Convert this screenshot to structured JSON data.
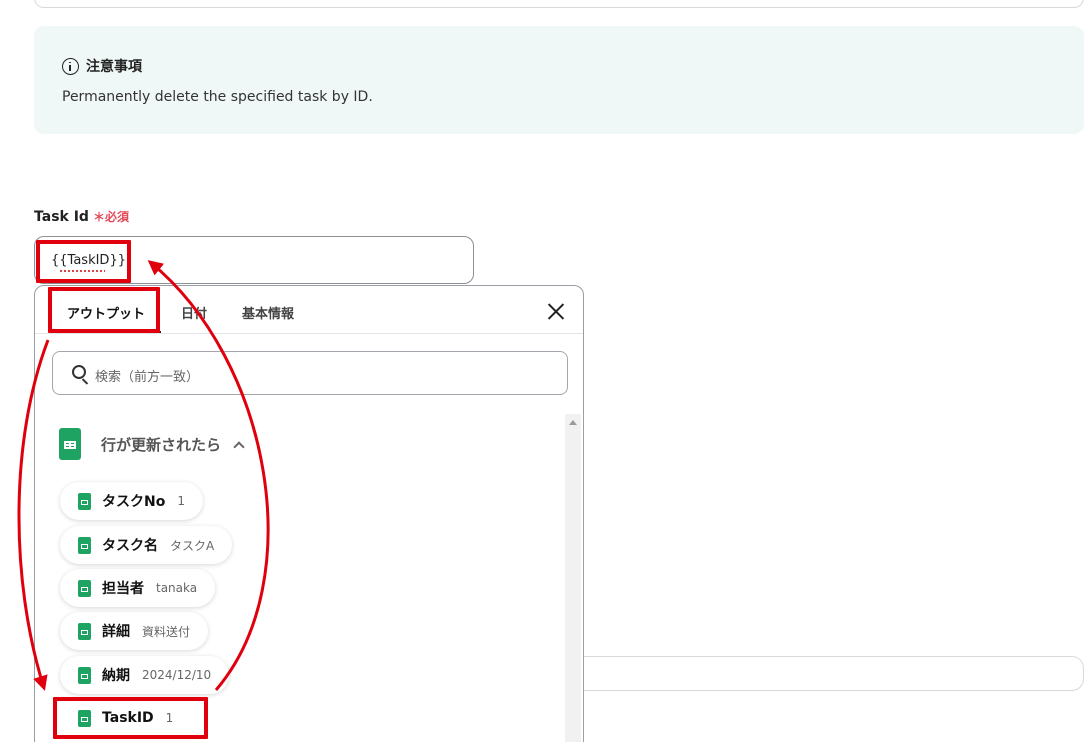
{
  "notice": {
    "title": "注意事項",
    "text": "Permanently delete the specified task by ID."
  },
  "field": {
    "label": "Task Id",
    "required": "＊必須",
    "value": "{{TaskID}}"
  },
  "popup": {
    "tabs": [
      "アウトプット",
      "日付",
      "基本情報"
    ],
    "active_tab": "アウトプット",
    "search_placeholder": "検索（前方一致）",
    "group": {
      "label": "行が更新されたら",
      "icon": "google-sheets-icon",
      "items": [
        {
          "label": "タスクNo",
          "value": "1"
        },
        {
          "label": "タスク名",
          "value": "タスクA"
        },
        {
          "label": "担当者",
          "value": "tanaka"
        },
        {
          "label": "詳細",
          "value": "資料送付"
        },
        {
          "label": "納期",
          "value": "2024/12/10"
        },
        {
          "label": "TaskID",
          "value": "1"
        }
      ]
    }
  },
  "annotation_color": "#e0000d",
  "accent_green": "#1ea362"
}
